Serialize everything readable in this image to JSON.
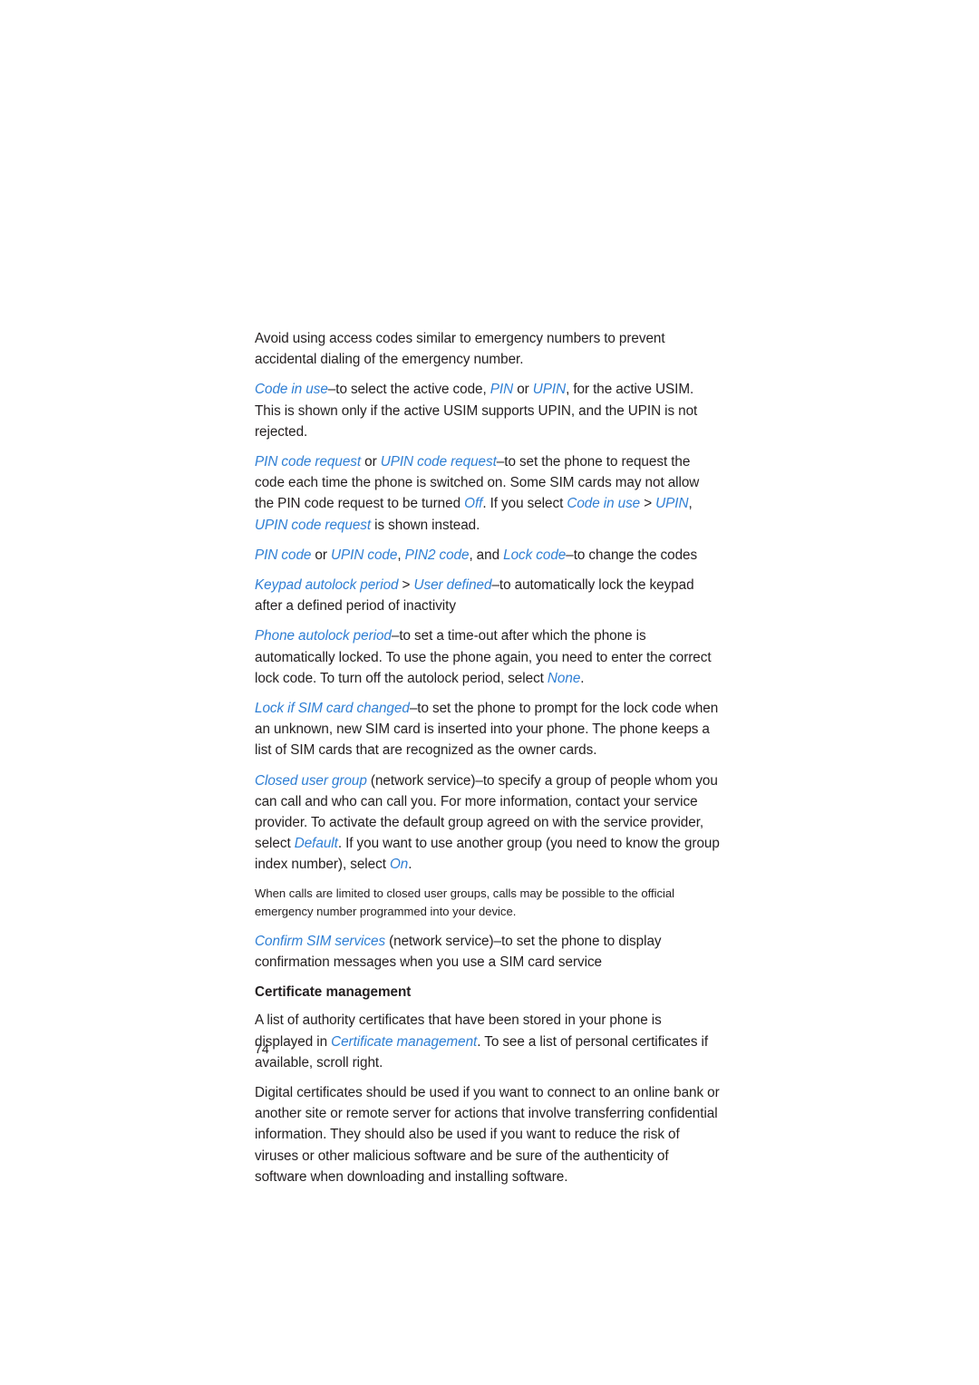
{
  "page": {
    "number": "74",
    "accent_color": "#2f7fd4",
    "text_color": "#231f20",
    "background_color": "#ffffff"
  },
  "paragraphs": [
    {
      "id": "avoid-access-codes",
      "style": "body",
      "runs": [
        {
          "text": "Avoid using access codes similar to emergency numbers to prevent accidental dialing of the emergency number.",
          "term": false
        }
      ]
    },
    {
      "id": "code-in-use",
      "style": "body",
      "runs": [
        {
          "text": "Code in use",
          "term": true
        },
        {
          "text": "–to select the active code, ",
          "term": false
        },
        {
          "text": "PIN",
          "term": true
        },
        {
          "text": " or ",
          "term": false
        },
        {
          "text": "UPIN",
          "term": true
        },
        {
          "text": ", for the active USIM. This is shown only if the active USIM supports UPIN, and the UPIN is not rejected.",
          "term": false
        }
      ]
    },
    {
      "id": "pin-code-request",
      "style": "body",
      "runs": [
        {
          "text": "PIN code request",
          "term": true
        },
        {
          "text": " or ",
          "term": false
        },
        {
          "text": "UPIN code request",
          "term": true
        },
        {
          "text": "–to set the phone to request the code each time the phone is switched on. Some SIM cards may not allow the PIN code request to be turned ",
          "term": false
        },
        {
          "text": "Off",
          "term": true
        },
        {
          "text": ". If you select ",
          "term": false
        },
        {
          "text": "Code in use",
          "term": true
        },
        {
          "text": " > ",
          "term": false
        },
        {
          "text": "UPIN",
          "term": true
        },
        {
          "text": ", ",
          "term": false
        },
        {
          "text": "UPIN code request",
          "term": true
        },
        {
          "text": " is shown instead.",
          "term": false
        }
      ]
    },
    {
      "id": "change-the-codes",
      "style": "body",
      "runs": [
        {
          "text": "PIN code",
          "term": true
        },
        {
          "text": " or ",
          "term": false
        },
        {
          "text": "UPIN code",
          "term": true
        },
        {
          "text": ", ",
          "term": false
        },
        {
          "text": "PIN2 code",
          "term": true
        },
        {
          "text": ", and ",
          "term": false
        },
        {
          "text": "Lock code",
          "term": true
        },
        {
          "text": "–to change the codes",
          "term": false
        }
      ]
    },
    {
      "id": "keypad-autolock-period",
      "style": "body",
      "runs": [
        {
          "text": "Keypad autolock period",
          "term": true
        },
        {
          "text": " > ",
          "term": false
        },
        {
          "text": "User defined",
          "term": true
        },
        {
          "text": "–to automatically lock the keypad after a defined period of inactivity",
          "term": false
        }
      ]
    },
    {
      "id": "phone-autolock-period",
      "style": "body",
      "runs": [
        {
          "text": "Phone autolock period",
          "term": true
        },
        {
          "text": "–to set a time-out after which the phone is automatically locked. To use the phone again, you need to enter the correct lock code. To turn off the autolock period, select ",
          "term": false
        },
        {
          "text": "None",
          "term": true
        },
        {
          "text": ".",
          "term": false
        }
      ]
    },
    {
      "id": "lock-if-sim-card-changed",
      "style": "body",
      "runs": [
        {
          "text": "Lock if SIM card changed",
          "term": true
        },
        {
          "text": "–to set the phone to prompt for the lock code when an unknown, new SIM card is inserted into your phone. The phone keeps a list of SIM cards that are recognized as the owner cards.",
          "term": false
        }
      ]
    },
    {
      "id": "closed-user-group",
      "style": "body",
      "runs": [
        {
          "text": "Closed user group",
          "term": true
        },
        {
          "text": " (network service)–to specify a group of people whom you can call and who can call you. For more information, contact your service provider. To activate the default group agreed on with the service provider, select ",
          "term": false
        },
        {
          "text": "Default",
          "term": true
        },
        {
          "text": ". If you want to use another group (you need to know the group index number), select ",
          "term": false
        },
        {
          "text": "On",
          "term": true
        },
        {
          "text": ".",
          "term": false
        }
      ]
    },
    {
      "id": "closed-user-group-note",
      "style": "note",
      "runs": [
        {
          "text": "When calls are limited to closed user groups, calls may be possible to the official emergency number programmed into your device.",
          "term": false
        }
      ]
    },
    {
      "id": "confirm-sim-services",
      "style": "body",
      "runs": [
        {
          "text": "Confirm SIM services",
          "term": true
        },
        {
          "text": " (network service)–to set the phone to display confirmation messages when you use a SIM card service",
          "term": false
        }
      ]
    },
    {
      "id": "certificate-management-heading",
      "style": "heading",
      "runs": [
        {
          "text": "Certificate management",
          "term": false
        }
      ]
    },
    {
      "id": "certificate-management-intro",
      "style": "body",
      "runs": [
        {
          "text": "A list of authority certificates that have been stored in your phone is displayed in ",
          "term": false
        },
        {
          "text": "Certificate management",
          "term": true
        },
        {
          "text": ". To see a list of personal certificates if available, scroll right.",
          "term": false
        }
      ]
    },
    {
      "id": "digital-certificates",
      "style": "body",
      "runs": [
        {
          "text": "Digital certificates should be used if you want to connect to an online bank or another site or remote server for actions that involve transferring confidential information. They should also be used if you want to reduce the risk of viruses or other malicious software and be sure of the authenticity of software when downloading and installing software.",
          "term": false
        }
      ]
    }
  ]
}
